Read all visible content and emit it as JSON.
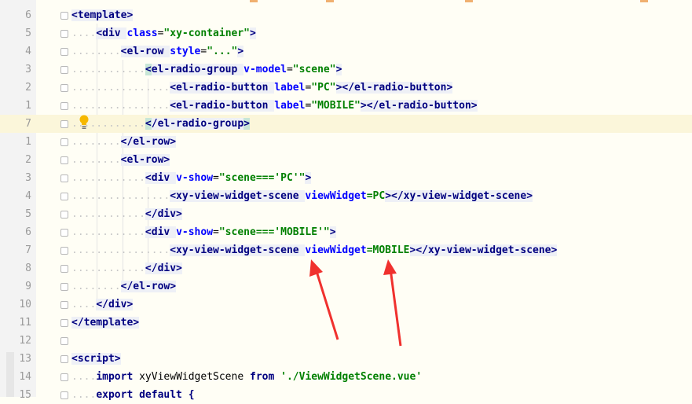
{
  "lines": [
    {
      "num": "6",
      "indent": "",
      "segments": [
        {
          "t": "<template>",
          "c": "tag"
        }
      ]
    },
    {
      "num": "5",
      "indent": "....",
      "segments": [
        {
          "t": "<div ",
          "c": "tag"
        },
        {
          "t": "class",
          "c": "attr"
        },
        {
          "t": "=",
          "c": "id"
        },
        {
          "t": "\"xy-container\"",
          "c": "val"
        },
        {
          "t": ">",
          "c": "tag"
        }
      ]
    },
    {
      "num": "4",
      "indent": "........",
      "segments": [
        {
          "t": "<el-row ",
          "c": "tag"
        },
        {
          "t": "style",
          "c": "attr"
        },
        {
          "t": "=",
          "c": "id"
        },
        {
          "t": "\"...\"",
          "c": "val"
        },
        {
          "t": ">",
          "c": "tag"
        }
      ]
    },
    {
      "num": "3",
      "indent": "............",
      "segments": [
        {
          "t": "<",
          "c": "tag hl"
        },
        {
          "t": "el-radio-group ",
          "c": "tag"
        },
        {
          "t": "v-model",
          "c": "attr"
        },
        {
          "t": "=",
          "c": "id"
        },
        {
          "t": "\"scene\"",
          "c": "val"
        },
        {
          "t": ">",
          "c": "tag"
        }
      ]
    },
    {
      "num": "2",
      "indent": "................",
      "segments": [
        {
          "t": "<el-radio-button ",
          "c": "tag"
        },
        {
          "t": "label",
          "c": "attr"
        },
        {
          "t": "=",
          "c": "id"
        },
        {
          "t": "\"PC\"",
          "c": "val"
        },
        {
          "t": "></el-radio-button>",
          "c": "tag"
        }
      ]
    },
    {
      "num": "1",
      "indent": "................",
      "segments": [
        {
          "t": "<el-radio-button ",
          "c": "tag"
        },
        {
          "t": "label",
          "c": "attr"
        },
        {
          "t": "=",
          "c": "id"
        },
        {
          "t": "\"MOBILE\"",
          "c": "val"
        },
        {
          "t": "></el-radio-button>",
          "c": "tag"
        }
      ]
    },
    {
      "num": "7",
      "indent": "............",
      "segments": [
        {
          "t": "<",
          "c": "tag hl"
        },
        {
          "t": "/el-radio-group",
          "c": "tag"
        },
        {
          "t": ">",
          "c": "tag hl"
        }
      ],
      "active": true
    },
    {
      "num": "1",
      "indent": "........",
      "segments": [
        {
          "t": "</el-row>",
          "c": "tag"
        }
      ]
    },
    {
      "num": "2",
      "indent": "........",
      "segments": [
        {
          "t": "<el-row>",
          "c": "tag"
        }
      ]
    },
    {
      "num": "3",
      "indent": "............",
      "segments": [
        {
          "t": "<div ",
          "c": "tag"
        },
        {
          "t": "v-show",
          "c": "attr"
        },
        {
          "t": "=",
          "c": "id"
        },
        {
          "t": "\"scene==='PC'\"",
          "c": "val"
        },
        {
          "t": ">",
          "c": "tag"
        }
      ]
    },
    {
      "num": "4",
      "indent": "................",
      "segments": [
        {
          "t": "<xy-view-widget-scene ",
          "c": "tag"
        },
        {
          "t": "viewWidget",
          "c": "attr"
        },
        {
          "t": "=PC",
          "c": "val"
        },
        {
          "t": "></xy-view-widget-scene>",
          "c": "tag"
        }
      ]
    },
    {
      "num": "5",
      "indent": "............",
      "segments": [
        {
          "t": "</div>",
          "c": "tag"
        }
      ]
    },
    {
      "num": "6",
      "indent": "............",
      "segments": [
        {
          "t": "<div ",
          "c": "tag"
        },
        {
          "t": "v-show",
          "c": "attr"
        },
        {
          "t": "=",
          "c": "id"
        },
        {
          "t": "\"scene==='MOBILE'\"",
          "c": "val"
        },
        {
          "t": ">",
          "c": "tag"
        }
      ]
    },
    {
      "num": "7",
      "indent": "................",
      "segments": [
        {
          "t": "<xy-view-widget-scene ",
          "c": "tag"
        },
        {
          "t": "viewWidget",
          "c": "attr"
        },
        {
          "t": "=MOBILE",
          "c": "val"
        },
        {
          "t": "></xy-view-widget-scene>",
          "c": "tag"
        }
      ]
    },
    {
      "num": "8",
      "indent": "............",
      "segments": [
        {
          "t": "</div>",
          "c": "tag"
        }
      ]
    },
    {
      "num": "9",
      "indent": "........",
      "segments": [
        {
          "t": "</el-row>",
          "c": "tag"
        }
      ]
    },
    {
      "num": "10",
      "indent": "....",
      "segments": [
        {
          "t": "</div>",
          "c": "tag"
        }
      ]
    },
    {
      "num": "11",
      "indent": "",
      "segments": [
        {
          "t": "</template>",
          "c": "tag"
        }
      ]
    },
    {
      "num": "12",
      "indent": "",
      "segments": []
    },
    {
      "num": "13",
      "indent": "",
      "segments": [
        {
          "t": "<script>",
          "c": "tag"
        }
      ]
    },
    {
      "num": "14",
      "indent": "....",
      "segments": [
        {
          "t": "import ",
          "c": "kw"
        },
        {
          "t": "xyViewWidgetScene ",
          "c": "id"
        },
        {
          "t": "from ",
          "c": "kw"
        },
        {
          "t": "'./ViewWidgetScene.vue'",
          "c": "str"
        }
      ]
    },
    {
      "num": "15",
      "indent": "....",
      "segments": [
        {
          "t": "export default {",
          "c": "kw"
        }
      ]
    }
  ],
  "intention_icon": "lightbulb-icon",
  "annotation_arrows": "red-arrow-icon"
}
